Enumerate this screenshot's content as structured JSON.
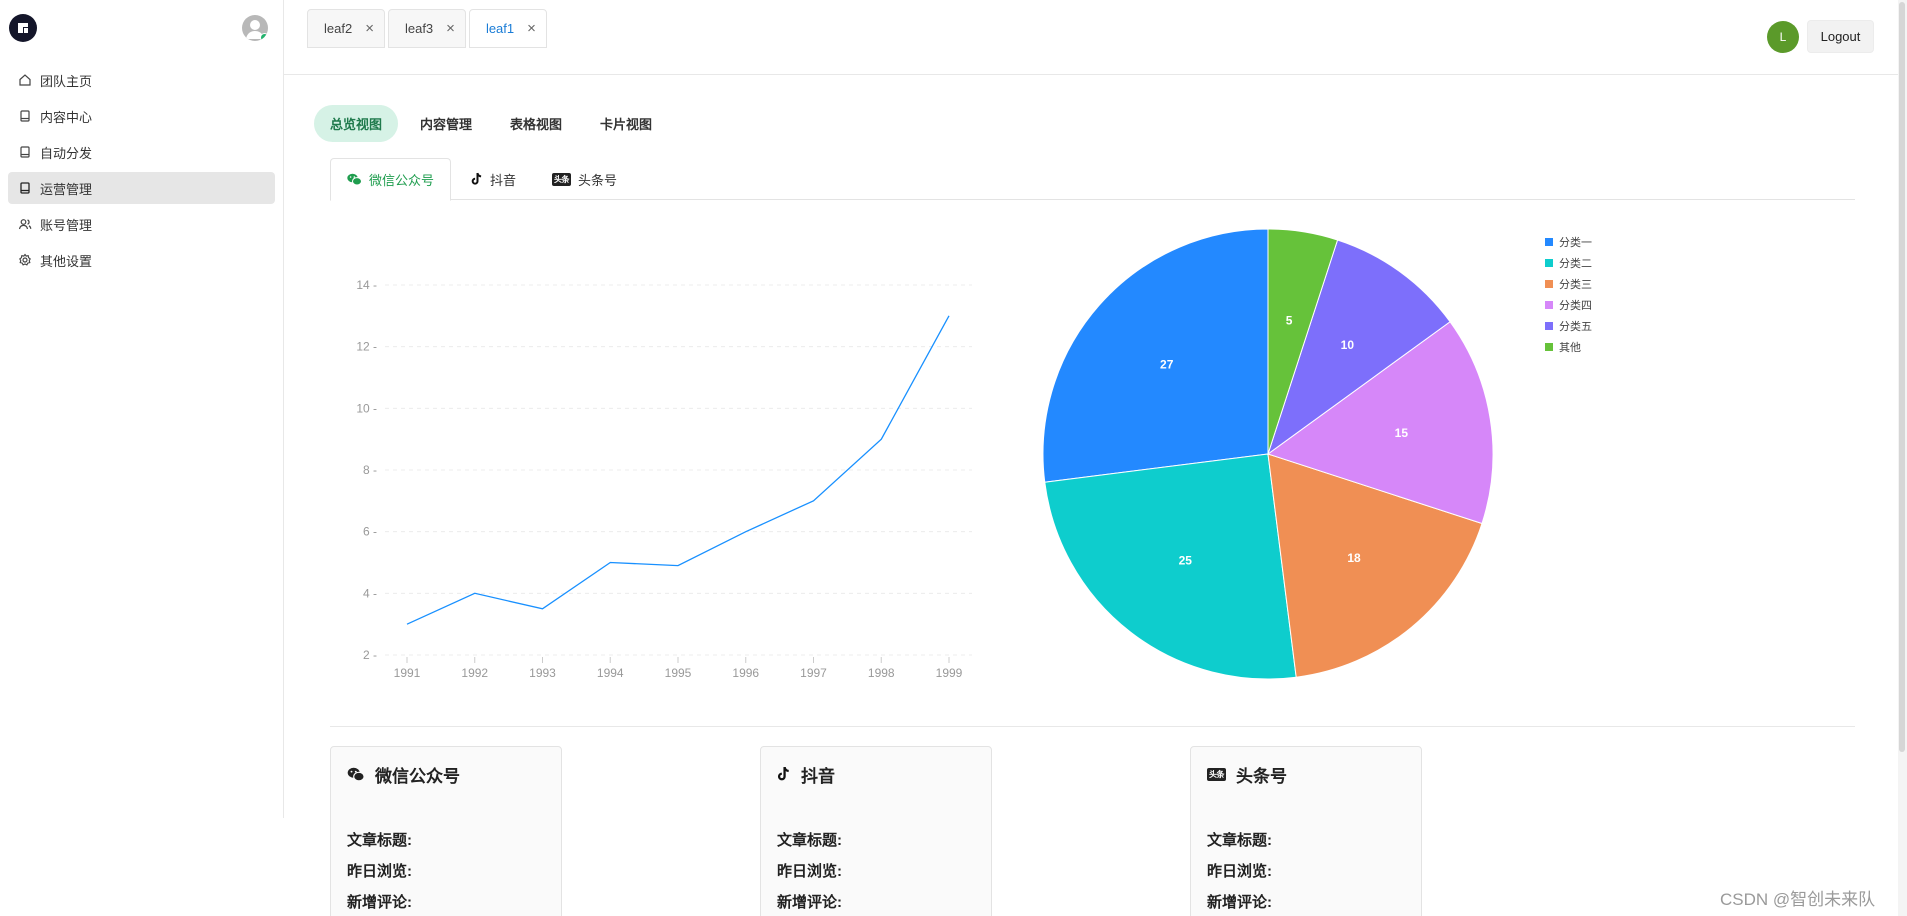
{
  "sidebar": {
    "items": [
      {
        "label": "团队主页",
        "icon": "home-icon"
      },
      {
        "label": "内容中心",
        "icon": "book-icon"
      },
      {
        "label": "自动分发",
        "icon": "book-icon"
      },
      {
        "label": "运营管理",
        "icon": "book-icon",
        "active": true
      },
      {
        "label": "账号管理",
        "icon": "users-icon"
      },
      {
        "label": "其他设置",
        "icon": "gear-icon"
      }
    ]
  },
  "header": {
    "tabs": [
      {
        "label": "leaf2",
        "active": false
      },
      {
        "label": "leaf3",
        "active": false
      },
      {
        "label": "leaf1",
        "active": true
      }
    ],
    "avatar_letter": "L",
    "logout_label": "Logout"
  },
  "view_tabs": [
    "总览视图",
    "内容管理",
    "表格视图",
    "卡片视图"
  ],
  "platform_tabs": [
    {
      "label": "微信公众号",
      "icon": "wechat-icon",
      "active": true
    },
    {
      "label": "抖音",
      "icon": "tiktok-icon",
      "active": false
    },
    {
      "label": "头条号",
      "icon": "toutiao-icon",
      "active": false
    }
  ],
  "toutiao_badge": "头条",
  "chart_data": [
    {
      "type": "line",
      "x": [
        "1991",
        "1992",
        "1993",
        "1994",
        "1995",
        "1996",
        "1997",
        "1998",
        "1999"
      ],
      "series": [
        {
          "values": [
            3,
            4,
            3.5,
            5,
            4.9,
            6,
            7,
            9,
            13
          ],
          "color": "#1890ff"
        }
      ],
      "ylim": [
        2,
        14
      ],
      "yticks": [
        2,
        4,
        6,
        8,
        10,
        12,
        14
      ],
      "grid": "horizontal dashed"
    },
    {
      "type": "pie",
      "slices": [
        {
          "name": "分类一",
          "value": 27,
          "color": "#2389ff"
        },
        {
          "name": "分类二",
          "value": 25,
          "color": "#0ecdcd"
        },
        {
          "name": "分类三",
          "value": 18,
          "color": "#f08f54"
        },
        {
          "name": "分类四",
          "value": 15,
          "color": "#d687f9"
        },
        {
          "name": "分类五",
          "value": 10,
          "color": "#7d6ffb"
        },
        {
          "name": "其他",
          "value": 5,
          "color": "#66c23a"
        }
      ],
      "legend": "top-right"
    }
  ],
  "cards": [
    {
      "title": "微信公众号",
      "icon": "wechat-icon",
      "fields": [
        "文章标题:",
        "昨日浏览:",
        "新增评论:"
      ]
    },
    {
      "title": "抖音",
      "icon": "tiktok-icon",
      "fields": [
        "文章标题:",
        "昨日浏览:",
        "新增评论:"
      ]
    },
    {
      "title": "头条号",
      "icon": "toutiao-icon",
      "fields": [
        "文章标题:",
        "昨日浏览:",
        "新增评论:"
      ]
    }
  ],
  "watermark": "CSDN @智创未来队"
}
